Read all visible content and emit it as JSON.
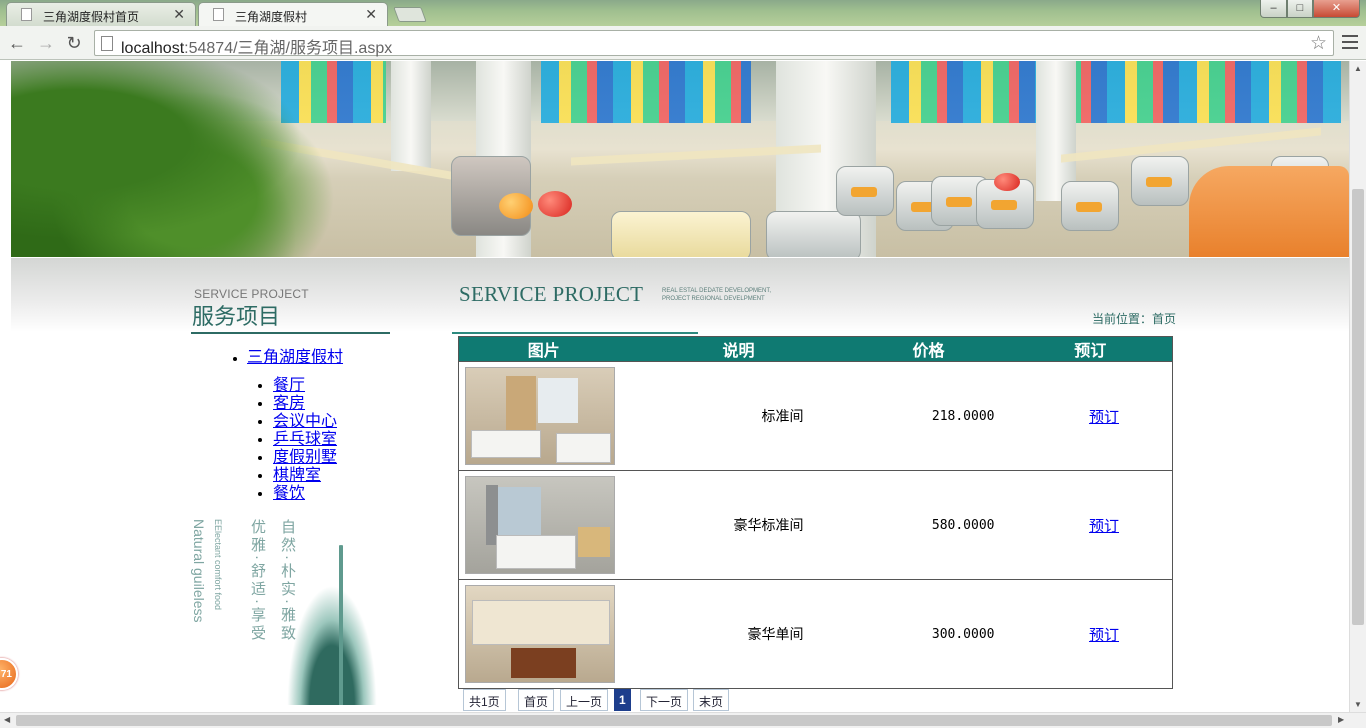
{
  "browser": {
    "tabs": [
      {
        "title": "三角湖度假村首页",
        "active": false
      },
      {
        "title": "三角湖度假村",
        "active": true
      }
    ],
    "address": {
      "host": "localhost",
      "rest": ":54874/三角湖/服务项目.aspx"
    },
    "window_buttons": {
      "minimize": "–",
      "maximize": "□",
      "close": "✕"
    },
    "nav": {
      "back": "←",
      "forward": "→",
      "reload": "↻"
    },
    "star": "☆"
  },
  "left": {
    "heading_en": "SERVICE PROJECT",
    "heading_cn": "服务项目",
    "root_link": "三角湖度假村",
    "links": [
      "餐厅",
      "客房",
      "会议中心",
      "乒乓球室",
      "度假别墅",
      "棋牌室",
      "餐饮"
    ],
    "deco_text_1": "Natural guileless",
    "deco_text_2": "EElectant comfort food",
    "deco_text_3": "优雅·舒适·享受",
    "deco_text_4": "自然·朴实·雅致"
  },
  "right": {
    "heading_en": "SERVICE PROJECT",
    "heading_sub_1": "REAL ESTAL DEDATE DEVELOPMENT,",
    "heading_sub_2": "PROJECT REGIONAL DEVELPMENT",
    "breadcrumb": "当前位置：首页",
    "columns": [
      "图片",
      "说明",
      "价格",
      "预订"
    ],
    "rows": [
      {
        "desc": "标准间",
        "price": "218.0000",
        "action": "预订"
      },
      {
        "desc": "豪华标准间",
        "price": "580.0000",
        "action": "预订"
      },
      {
        "desc": "豪华单间",
        "price": "300.0000",
        "action": "预订"
      }
    ],
    "pager": {
      "total": "共1页",
      "first": "首页",
      "prev": "上一页",
      "current": "1",
      "next": "下一页",
      "last": "末页"
    }
  },
  "floater_badge": "71",
  "colors": {
    "accent": "#0f7a72",
    "heading": "#2d6b64",
    "link": "#0000ee",
    "pager_current": "#1d3e8c"
  }
}
